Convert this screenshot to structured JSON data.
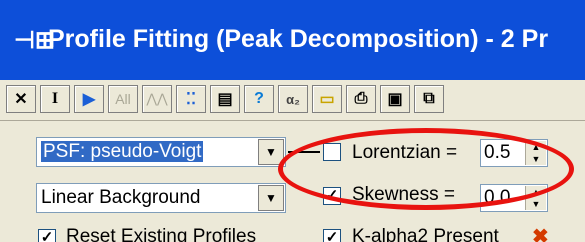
{
  "window": {
    "title": "Profile Fitting (Peak Decomposition) - 2 Pr",
    "icon": "app-icon"
  },
  "toolbar": {
    "buttons": [
      {
        "name": "close-x-button",
        "label": "✕"
      },
      {
        "name": "cursor-button",
        "label": "I"
      },
      {
        "name": "play-button",
        "label": "▶"
      },
      {
        "name": "all-button",
        "label": "All"
      },
      {
        "name": "peaks-button",
        "label": "⋀⋀"
      },
      {
        "name": "marks-button",
        "label": "⁚⁚"
      },
      {
        "name": "panel-button",
        "label": "▤"
      },
      {
        "name": "help-button",
        "label": "?"
      },
      {
        "name": "alpha-button",
        "label": "α₂"
      },
      {
        "name": "folder-button",
        "label": "▭"
      },
      {
        "name": "print-button",
        "label": "⎙"
      },
      {
        "name": "save-button",
        "label": "▣"
      },
      {
        "name": "copy-button",
        "label": "⧉"
      }
    ]
  },
  "settings": {
    "psf_select": "PSF: pseudo-Voigt",
    "background_select": "Linear Background",
    "lorentzian": {
      "label": "Lorentzian =",
      "value": "0.5",
      "checked": false
    },
    "skewness": {
      "label": "Skewness =",
      "value": "0.0",
      "checked": true
    },
    "reset_profiles": {
      "label": "Reset Existing Profiles",
      "checked": true
    },
    "kalpha2": {
      "label": "K-alpha2 Present",
      "checked": true
    }
  },
  "colors": {
    "titlebar": "#0d4fd9",
    "highlight_ellipse": "#e8130f",
    "selection": "#316ac5"
  }
}
